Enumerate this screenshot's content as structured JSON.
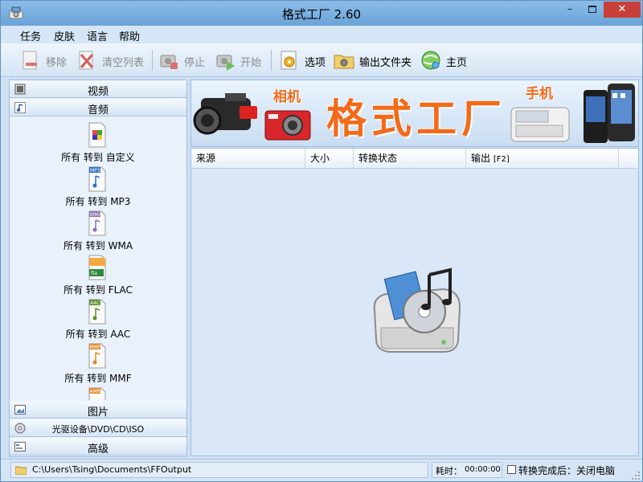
{
  "window": {
    "title": "格式工厂 2.60",
    "controls": {
      "minimize": "–",
      "close": "✕"
    }
  },
  "menu": [
    "任务",
    "皮肤",
    "语言",
    "帮助"
  ],
  "toolbar": {
    "remove": "移除",
    "clear_list": "清空列表",
    "stop": "停止",
    "start": "开始",
    "options": "选项",
    "output_folder": "输出文件夹",
    "home": "主页"
  },
  "sidebar": {
    "categories_top": [
      "视频",
      "音频"
    ],
    "formats": [
      "所有 转到 自定义",
      "所有 转到 MP3",
      "所有 转到 WMA",
      "所有 转到 FLAC",
      "所有 转到 AAC",
      "所有 转到 MMF"
    ],
    "format_icon_tags": [
      "",
      "MP3",
      "WMA",
      "fla",
      "AAC",
      "MMF",
      "AMR"
    ],
    "categories_bottom": [
      "图片",
      "光驱设备\\DVD\\CD\\ISO",
      "高级"
    ]
  },
  "banner": {
    "title": "格式工厂",
    "camera_label": "相机",
    "phone_label": "手机"
  },
  "table": {
    "columns": [
      "来源",
      "大小",
      "转换状态",
      "输出"
    ],
    "output_shortcut": "[F2]"
  },
  "status": {
    "output_path": "C:\\Users\\Tsing\\Documents\\FFOutput",
    "elapsed_label": "耗时：",
    "elapsed_value": "00:00:00",
    "after_done": "转换完成后：关闭电脑"
  },
  "colors": {
    "accent_orange": "#f36a19",
    "close_red": "#c7413a",
    "titlebar_blue": "#6aa3d8"
  }
}
